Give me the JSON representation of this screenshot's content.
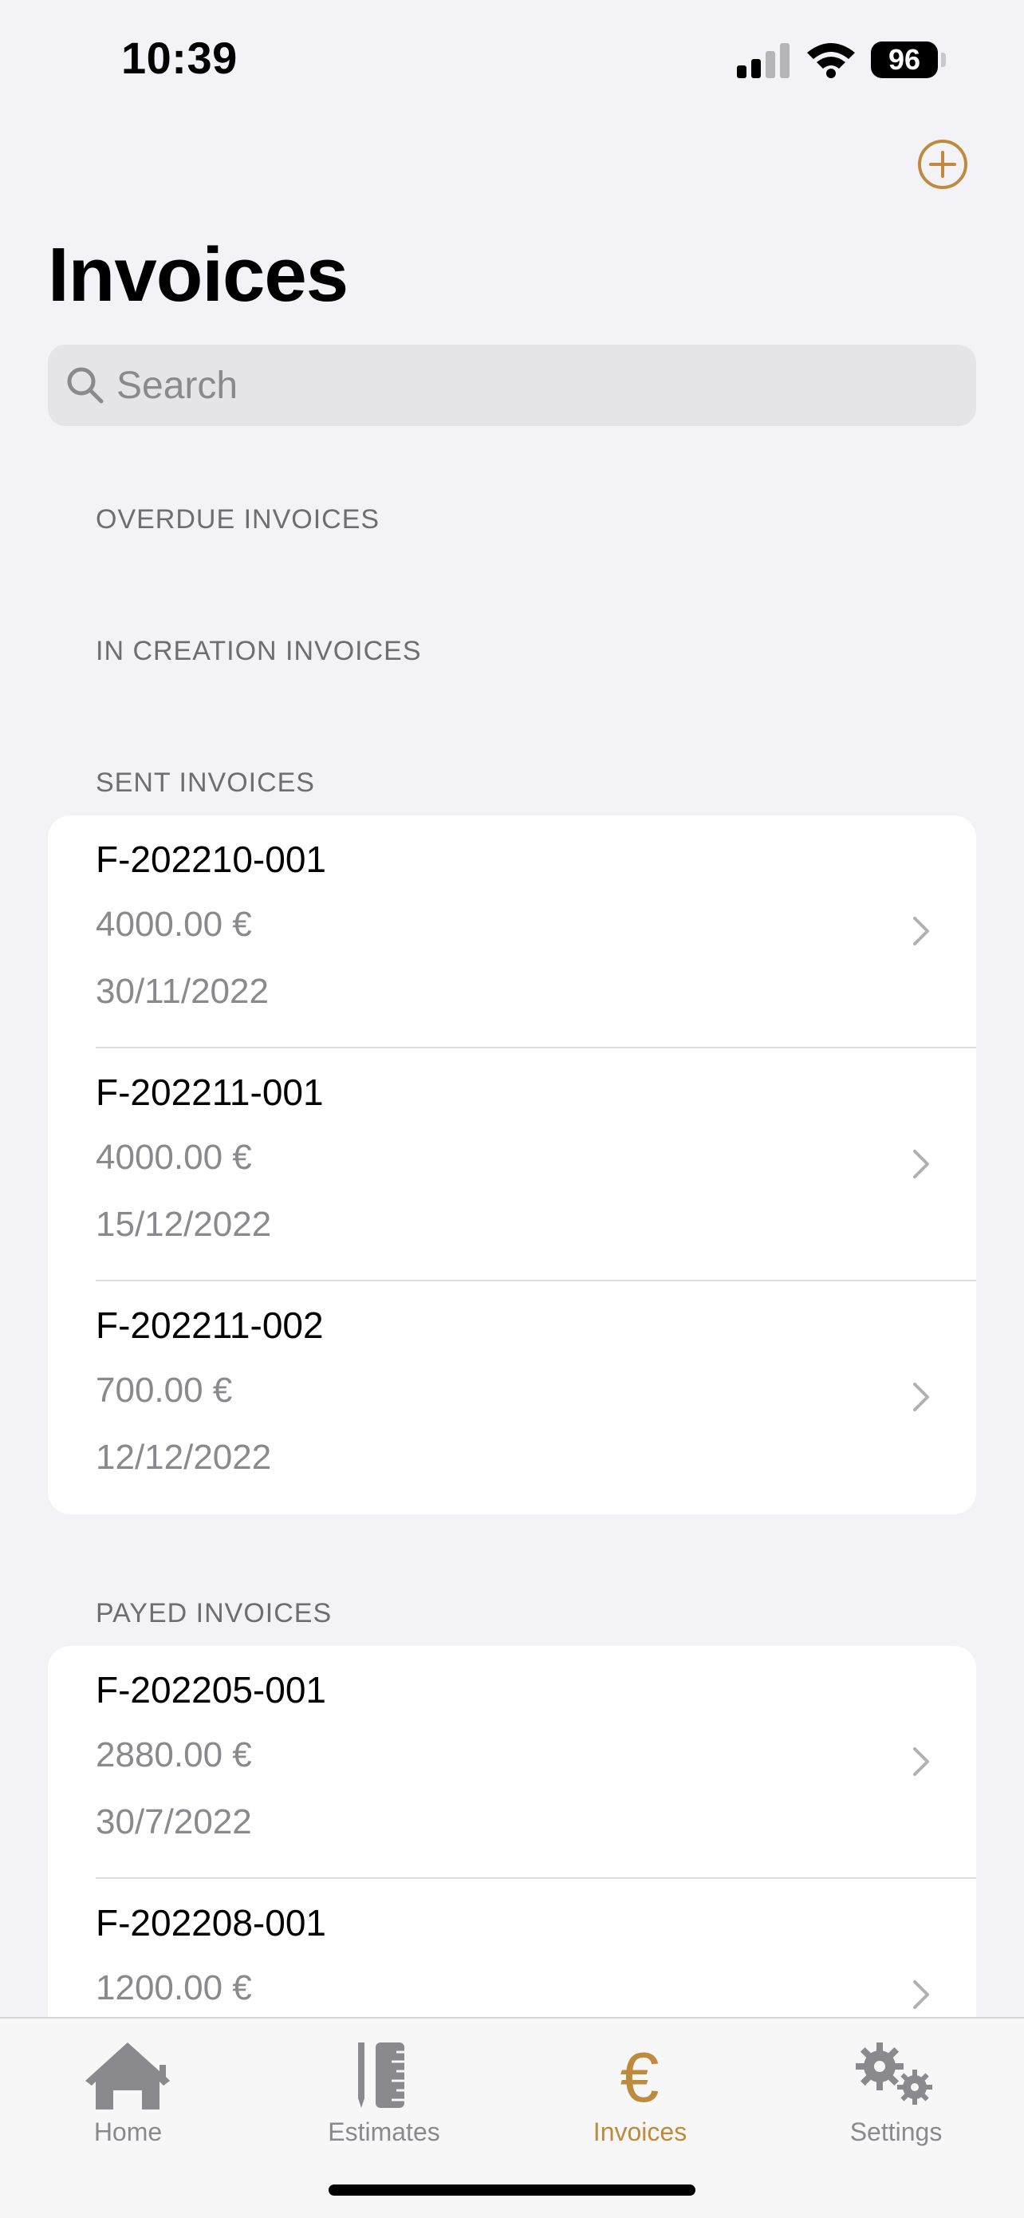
{
  "status_bar": {
    "time": "10:39",
    "battery": "96"
  },
  "header": {
    "title": "Invoices",
    "add_icon": "plus-circle-icon"
  },
  "search": {
    "placeholder": "Search",
    "value": ""
  },
  "sections": {
    "overdue": {
      "title": "OVERDUE INVOICES"
    },
    "in_creation": {
      "title": "IN CREATION INVOICES"
    },
    "sent": {
      "title": "SENT INVOICES",
      "rows": [
        {
          "number": "F-202210-001",
          "amount": "4000.00 €",
          "date": "30/11/2022"
        },
        {
          "number": "F-202211-001",
          "amount": "4000.00 €",
          "date": "15/12/2022"
        },
        {
          "number": "F-202211-002",
          "amount": "700.00 €",
          "date": "12/12/2022"
        }
      ]
    },
    "payed": {
      "title": "PAYED INVOICES",
      "rows": [
        {
          "number": "F-202205-001",
          "amount": "2880.00 €",
          "date": "30/7/2022"
        },
        {
          "number": "F-202208-001",
          "amount": "1200.00 €",
          "date": ""
        }
      ]
    }
  },
  "tabs": [
    {
      "label": "Home",
      "icon": "house-icon",
      "active": false
    },
    {
      "label": "Estimates",
      "icon": "ruler-pencil-icon",
      "active": false
    },
    {
      "label": "Invoices",
      "icon": "euro-icon",
      "active": true
    },
    {
      "label": "Settings",
      "icon": "gears-icon",
      "active": false
    }
  ],
  "colors": {
    "accent": "#c08a3e",
    "background": "#f2f2f7",
    "secondary_text": "#8a8a8e"
  }
}
